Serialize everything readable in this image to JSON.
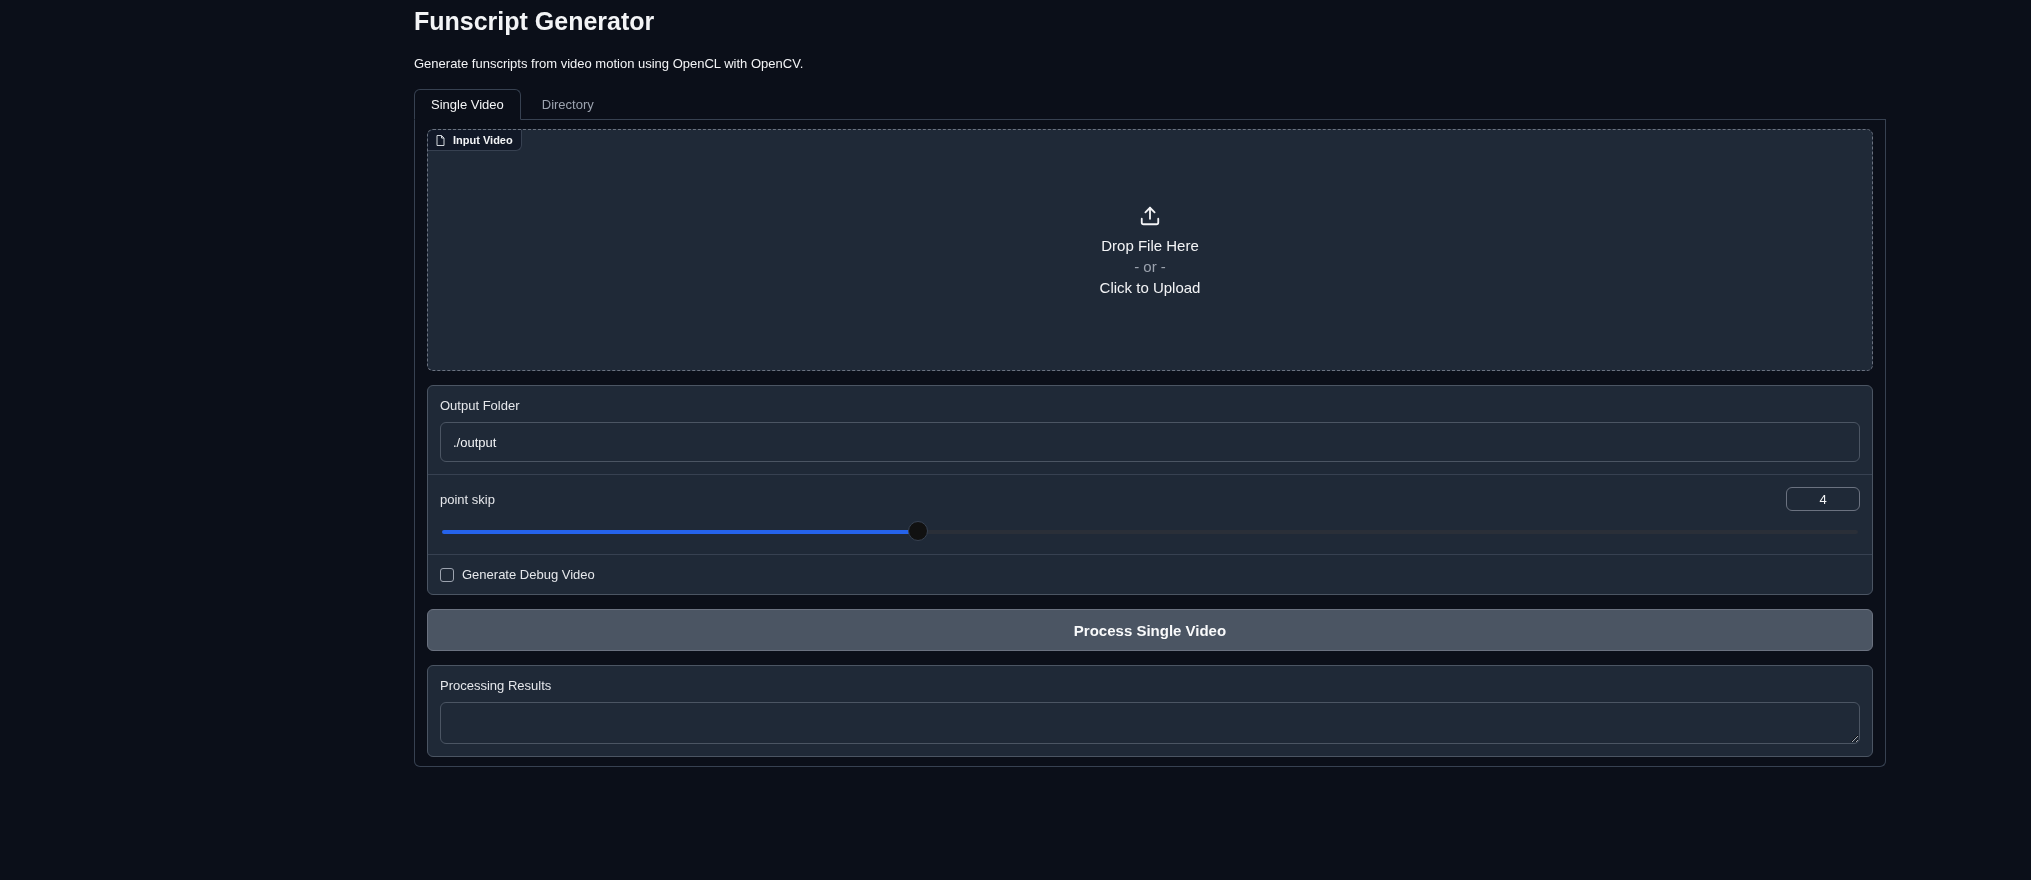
{
  "title": "Funscript Generator",
  "description": "Generate funscripts from video motion using OpenCL with OpenCV.",
  "tabs": [
    {
      "label": "Single Video",
      "selected": true
    },
    {
      "label": "Directory",
      "selected": false
    }
  ],
  "upload": {
    "label": "Input Video",
    "drop_text": "Drop File Here",
    "or_text": "- or -",
    "click_text": "Click to Upload"
  },
  "output_folder": {
    "label": "Output Folder",
    "value": "./output"
  },
  "point_skip": {
    "label": "point skip",
    "value": "4",
    "level": 0.336
  },
  "debug_video": {
    "label": "Generate Debug Video",
    "checked": false
  },
  "process_button": "Process Single Video",
  "results": {
    "label": "Processing Results"
  }
}
